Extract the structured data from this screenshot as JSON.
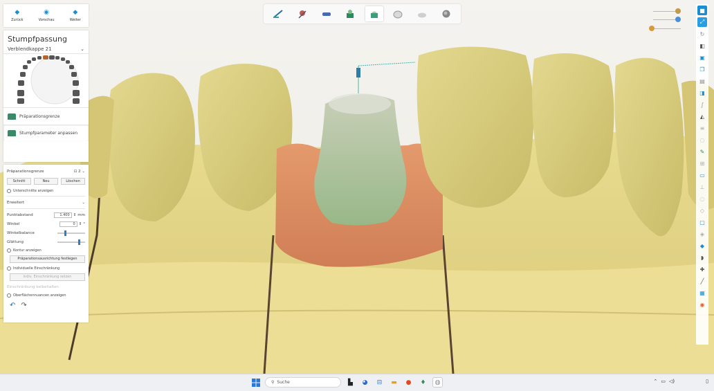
{
  "navigation": {
    "back_label": "Zurück",
    "preview_label": "Vorschau",
    "next_label": "Weiter"
  },
  "panel": {
    "title": "Stumpfpassung",
    "restoration_label": "Verblendkappe 21",
    "steps": [
      {
        "label": "Präparationsgrenze"
      },
      {
        "label": "Stumpfparameter anpassen"
      }
    ]
  },
  "prep_line": {
    "header_label": "Präparationsgrenze",
    "count_label": "2",
    "buttons": {
      "cut": "Schnitt",
      "new": "Neu",
      "delete": "Löschen"
    },
    "partial_label": "Unterschnitte anzeigen"
  },
  "advanced": {
    "header_label": "Erweitert",
    "point_distance_label": "Punktabstand",
    "point_distance_value": "1.400",
    "point_distance_unit": "mm",
    "angle_label": "Winkel",
    "angle_value": "0",
    "angle_unit": "°",
    "angle_balance_label": "Winkelbalance",
    "smoothing_label": "Glättung",
    "smoothing_level": 0.75,
    "angle_balance_level": 0.25,
    "show_profile_label": "Kontur anzeigen",
    "set_direction_button": "Präparationsausrichtung festlegen",
    "individual_limit_label": "Individuelle Einschränkung",
    "limit_button": "Indiv. Einschränkung setzen",
    "extra_disabled_label": "Einschränkung beibehalten",
    "show_surface_label": "Oberflächennuancen anzeigen"
  },
  "taskbar": {
    "search_placeholder": "Suche"
  },
  "colors": {
    "accent": "#1a8fd0",
    "gum": "#d98a5e",
    "tooth": "#dcd284",
    "die": "#a8c29a",
    "model": "#e3d68b"
  }
}
